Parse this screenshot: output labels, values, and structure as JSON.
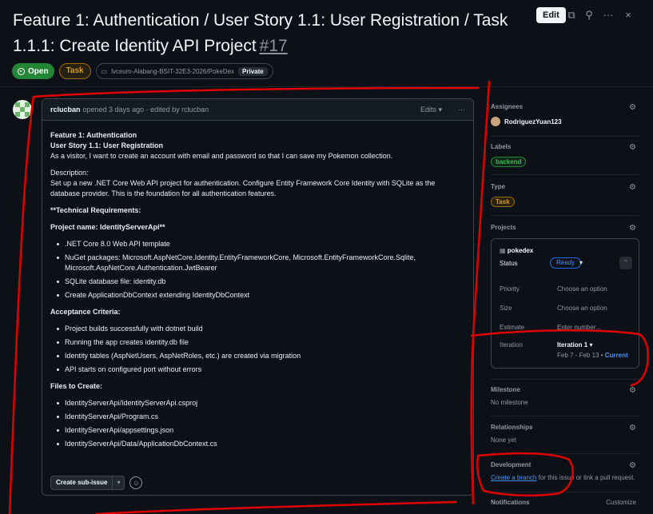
{
  "issue": {
    "title": "Feature 1: Authentication / User Story 1.1: User Registration / Task 1.1.1: Create Identity API Project",
    "number": "#17",
    "state": "Open",
    "type": "Task",
    "repo": "lvceum-Alabang-BSIT-32E3-2026/PokeDex",
    "visibility": "Private"
  },
  "header": {
    "edit_label": "Edit"
  },
  "comment": {
    "author": "rclucban",
    "meta": "opened 3 days ago · edited by rclucban",
    "edits_label": "Edits",
    "more": "···",
    "lines": {
      "l1": "Feature 1: Authentication",
      "l2": "User Story 1.1: User Registration",
      "l3": "As a visitor, I want to create an account with email and password so that I can save my Pokemon collection.",
      "desc_label": "Description:",
      "desc": "Set up a new .NET Core Web API project for authentication. Configure Entity Framework Core Identity with SQLite as the database provider. This is the foundation for all authentication features.",
      "tech": "**Technical Requirements:",
      "project_name": "Project name: IdentityServerApi**",
      "acceptance": "Acceptance Criteria:",
      "files": "Files to Create:"
    },
    "tech_items": [
      ".NET Core 8.0 Web API template",
      "NuGet packages: Microsoft.AspNetCore.Identity.EntityFrameworkCore, Microsoft.EntityFrameworkCore.Sqlite, Microsoft.AspNetCore.Authentication.JwtBearer",
      "SQLite database file: identity.db",
      "Create ApplicationDbContext extending IdentityDbContext"
    ],
    "acceptance_items": [
      "Project builds successfully with dotnet build",
      "Running the app creates identity.db file",
      "Identity tables (AspNetUsers, AspNetRoles, etc.) are created via migration",
      "API starts on configured port without errors"
    ],
    "file_items": [
      "IdentityServerApi/IdentityServerApi.csproj",
      "IdentityServerApi/Program.cs",
      "IdentityServerApi/appsettings.json",
      "IdentityServerApi/Data/ApplicationDbContext.cs"
    ],
    "create_sub_issue": "Create sub-issue"
  },
  "sidebar": {
    "assignees_label": "Assignees",
    "assignee": "RodriguezYuan123",
    "labels_label": "Labels",
    "label": "backend",
    "type_label": "Type",
    "type": "Task",
    "projects_label": "Projects",
    "project": {
      "name": "pokedex",
      "status_label": "Status",
      "status": "Ready",
      "priority_label": "Priority",
      "priority": "Choose an option",
      "size_label": "Size",
      "size": "Choose an option",
      "estimate_label": "Estimate",
      "estimate": "Enter number...",
      "iteration_label": "Iteration",
      "iteration": "Iteration 1",
      "iteration_dates": "Feb 7 - Feb 13",
      "iteration_current": "Current"
    },
    "milestone_label": "Milestone",
    "milestone": "No milestone",
    "relationships_label": "Relationships",
    "relationships": "None yet",
    "development_label": "Development",
    "dev_link": "Create a branch",
    "dev_text": " for this issue or link a pull request.",
    "notifications_label": "Notifications",
    "customize": "Customize"
  },
  "colors": {
    "accent": "#4493f8",
    "open": "#238636",
    "task": "#d29922",
    "backend": "#3fb950",
    "annotation": "#e00000"
  },
  "icons": [
    "open-circle-icon",
    "repo-icon",
    "copy-icon",
    "pin-icon",
    "kebab-icon",
    "close-icon",
    "gear-icon",
    "table-icon",
    "smiley-icon"
  ]
}
